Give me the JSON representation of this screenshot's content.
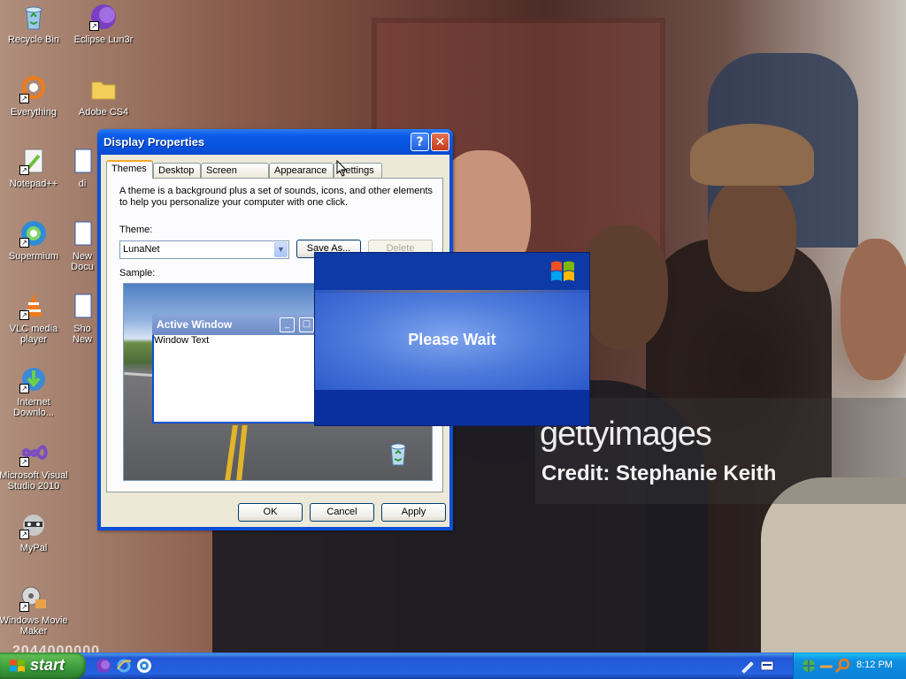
{
  "desktop": {
    "icons": [
      {
        "label": "Recycle Bin"
      },
      {
        "label": "Eclipse Lun3r"
      },
      {
        "label": "Everything"
      },
      {
        "label": "Adobe CS4"
      },
      {
        "label": "Notepad++"
      },
      {
        "label": "Supermium"
      },
      {
        "label": "VLC media player"
      },
      {
        "label": "Internet Downlo..."
      },
      {
        "label": "Microsoft Visual Studio 2010"
      },
      {
        "label": "MyPal"
      },
      {
        "label": "Windows Movie Maker"
      }
    ],
    "partial_labels": {
      "di": "di",
      "new_doc": "New Docu",
      "sho_new": "Sho New"
    }
  },
  "watermark": {
    "logo": "gettyimages",
    "credit": "Credit: Stephanie Keith",
    "stock_id": "2044000000"
  },
  "dialog": {
    "title": "Display Properties",
    "tabs": [
      "Themes",
      "Desktop",
      "Screen Saver",
      "Appearance",
      "Settings"
    ],
    "active_tab": "Themes",
    "description": "A theme is a background plus a set of sounds, icons, and other elements to help you personalize your computer with one click.",
    "theme_label": "Theme:",
    "theme_value": "LunaNet",
    "save_as": "Save As...",
    "delete": "Delete",
    "sample_label": "Sample:",
    "sample_window_title": "Active Window",
    "sample_window_text": "Window Text",
    "ok": "OK",
    "cancel": "Cancel",
    "apply": "Apply"
  },
  "please_wait": {
    "text": "Please Wait"
  },
  "taskbar": {
    "start_label": "start",
    "clock": "8:12 PM"
  },
  "colors": {
    "xp_blue": "#0a4fd6",
    "start_green": "#3c9b3c",
    "tray_blue": "#0b80d8"
  }
}
